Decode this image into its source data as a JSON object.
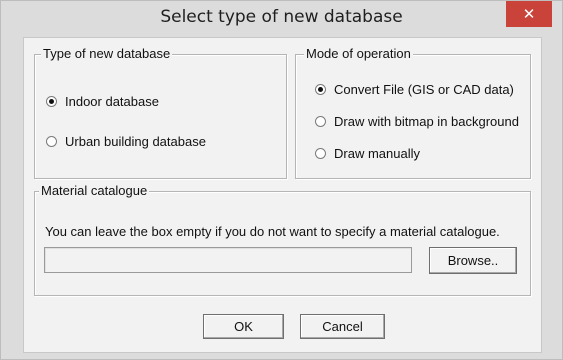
{
  "window": {
    "title": "Select type of new database",
    "close_glyph": "✕"
  },
  "db_type_group": {
    "legend": "Type of new database",
    "options": [
      {
        "label": "Indoor database",
        "selected": true
      },
      {
        "label": "Urban building database",
        "selected": false
      }
    ]
  },
  "mode_group": {
    "legend": "Mode of operation",
    "options": [
      {
        "label": "Convert File (GIS or CAD data)",
        "selected": true
      },
      {
        "label": "Draw with bitmap in background",
        "selected": false
      },
      {
        "label": "Draw manually",
        "selected": false
      }
    ]
  },
  "material_group": {
    "legend": "Material catalogue",
    "hint": "You can leave the box empty if you do not want to specify a material catalogue.",
    "path_value": "",
    "browse_label": "Browse.."
  },
  "footer": {
    "ok_label": "OK",
    "cancel_label": "Cancel"
  },
  "colors": {
    "close_button": "#c9433b",
    "dialog_face": "#f2f2f2",
    "frame": "#dcdcdc"
  }
}
